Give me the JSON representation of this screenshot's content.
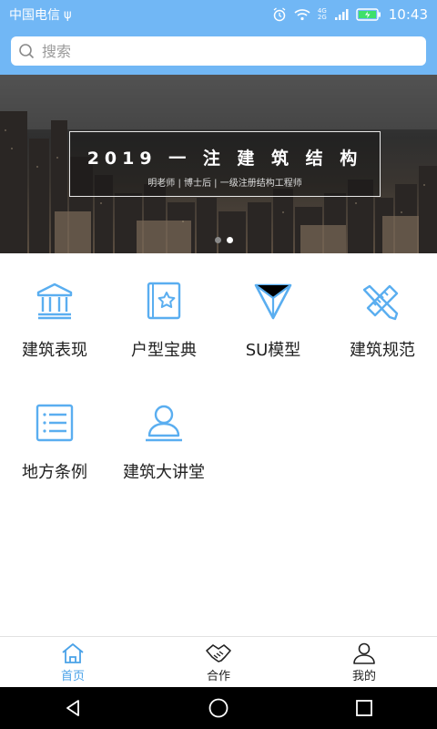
{
  "status_bar": {
    "carrier": "中国电信",
    "usb_symbol": "ψ",
    "time": "10:43",
    "network_4g": "4G",
    "network_2g": "2G"
  },
  "search": {
    "placeholder": "搜索",
    "value": ""
  },
  "banner": {
    "title": "2019 一 注 建 筑 结 构",
    "subtitle": "明老师 | 博士后 | 一级注册结构工程师",
    "page_count": 2,
    "active_page": 2
  },
  "grid": {
    "items": [
      {
        "label": "建筑表现",
        "icon": "building-columns-icon"
      },
      {
        "label": "户型宝典",
        "icon": "star-book-icon"
      },
      {
        "label": "SU模型",
        "icon": "triangle-model-icon"
      },
      {
        "label": "建筑规范",
        "icon": "ruler-pencil-icon"
      },
      {
        "label": "地方条例",
        "icon": "list-document-icon"
      },
      {
        "label": "建筑大讲堂",
        "icon": "lecturer-person-icon"
      }
    ]
  },
  "tabs": [
    {
      "label": "首页",
      "icon": "home-icon",
      "active": true
    },
    {
      "label": "合作",
      "icon": "handshake-icon",
      "active": false
    },
    {
      "label": "我的",
      "icon": "user-icon",
      "active": false
    }
  ],
  "colors": {
    "header": "#71b7f5",
    "icon_blue": "#5aaef0",
    "active_tab": "#4aa2e8"
  }
}
